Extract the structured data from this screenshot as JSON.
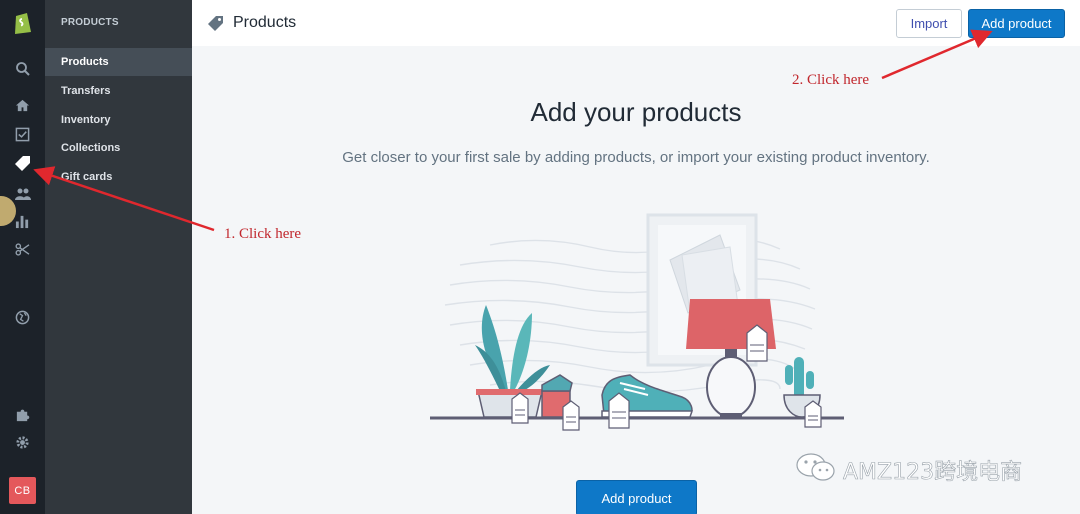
{
  "rail": {
    "icons": [
      "shopify-logo-icon",
      "search-icon",
      "home-icon",
      "orders-icon",
      "products-tag-icon",
      "customers-icon",
      "analytics-icon",
      "discounts-icon",
      "globe-icon",
      "apps-icon",
      "settings-icon"
    ],
    "active": "products-tag-icon",
    "avatar_initials": "CB",
    "avatar_color": "#e4585b"
  },
  "subnav": {
    "title": "PRODUCTS",
    "items": [
      {
        "label": "Products",
        "active": true
      },
      {
        "label": "Transfers",
        "active": false
      },
      {
        "label": "Inventory",
        "active": false
      },
      {
        "label": "Collections",
        "active": false
      },
      {
        "label": "Gift cards",
        "active": false
      }
    ]
  },
  "header": {
    "title": "Products",
    "import_label": "Import",
    "add_label": "Add product"
  },
  "main": {
    "heading": "Add your products",
    "subtitle": "Get closer to your first sale by adding products, or import your existing product inventory.",
    "add_label": "Add product"
  },
  "annotations": {
    "step1": "1. Click here",
    "step2": "2. Click here"
  },
  "watermark": {
    "text": "AMZ123跨境电商"
  },
  "colors": {
    "primary": "#0e78c8",
    "rail_bg": "#1c2229",
    "subnav_bg": "#31373d",
    "annotation": "#c1272d"
  }
}
